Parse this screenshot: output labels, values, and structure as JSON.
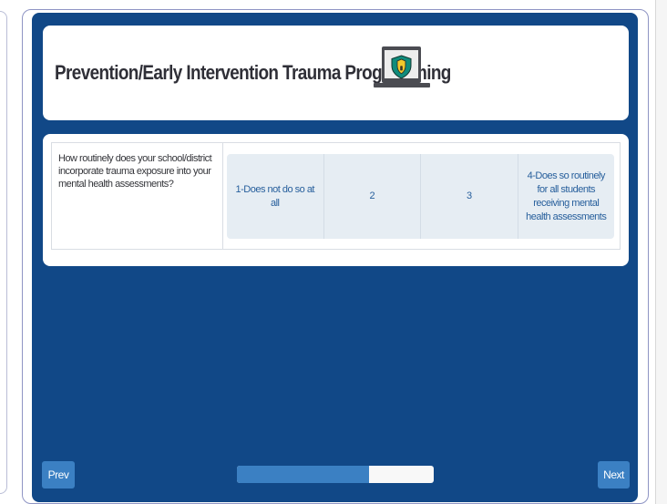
{
  "survey": {
    "title": "Prevention/Early Intervention Trauma Programming",
    "title_icon": "laptop-shield-icon",
    "question": "How routinely does your school/district incorporate trauma exposure into your mental health assessments?",
    "options": [
      {
        "label": "1-Does not do so at all"
      },
      {
        "label": "2"
      },
      {
        "label": "3"
      },
      {
        "label": "4-Does so routinely for all students receiving mental health assessments"
      }
    ]
  },
  "navigation": {
    "prev_label": "Prev",
    "next_label": "Next",
    "progress_percent": 67
  },
  "colors": {
    "panel_background": "#114887",
    "button_color": "#3b80c3",
    "option_text_color": "#275f9c"
  }
}
